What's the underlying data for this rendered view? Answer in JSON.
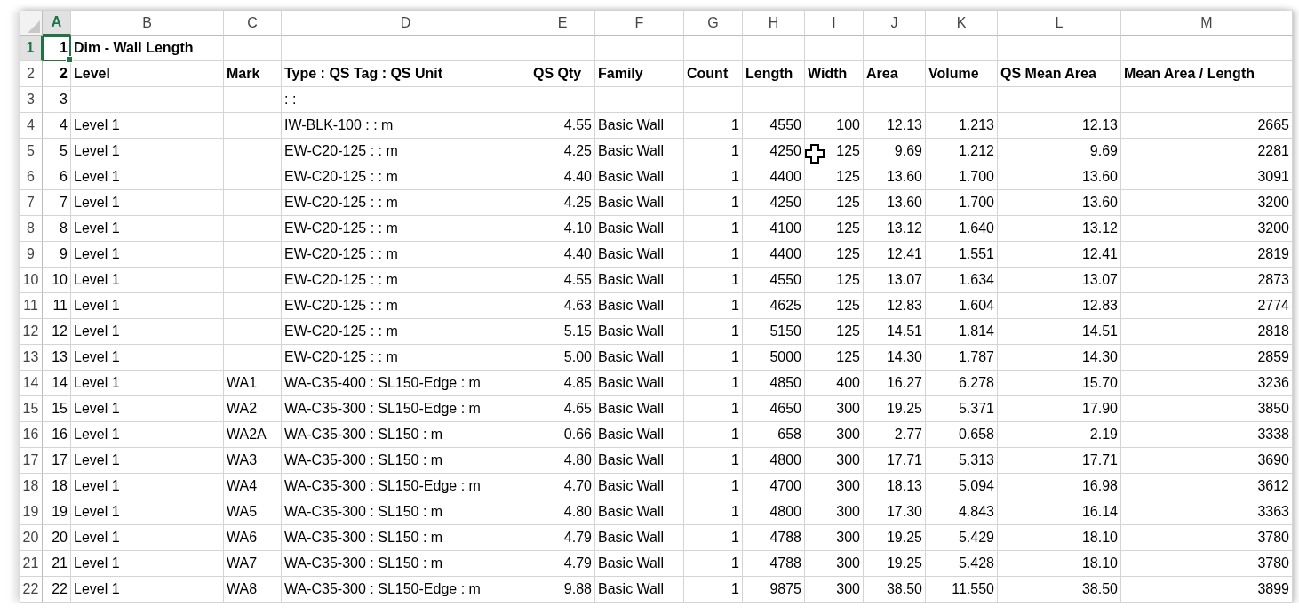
{
  "columns": [
    {
      "label": "A",
      "selected": true
    },
    {
      "label": "B",
      "selected": false
    },
    {
      "label": "C",
      "selected": false
    },
    {
      "label": "D",
      "selected": false
    },
    {
      "label": "E",
      "selected": false
    },
    {
      "label": "F",
      "selected": false
    },
    {
      "label": "G",
      "selected": false
    },
    {
      "label": "H",
      "selected": false
    },
    {
      "label": "I",
      "selected": false
    },
    {
      "label": "J",
      "selected": false
    },
    {
      "label": "K",
      "selected": false
    },
    {
      "label": "L",
      "selected": false
    },
    {
      "label": "M",
      "selected": false
    }
  ],
  "rows": [
    {
      "number": "1",
      "selected": true,
      "kind": "title",
      "cells": [
        "1",
        "Dim - Wall Length",
        "",
        "",
        "",
        "",
        "",
        "",
        "",
        "",
        "",
        "",
        ""
      ]
    },
    {
      "number": "2",
      "selected": false,
      "kind": "header",
      "cells": [
        "2",
        "Level",
        "Mark",
        "Type : QS Tag : QS Unit",
        "QS Qty",
        "Family",
        "Count",
        "Length",
        "Width",
        "Area",
        "Volume",
        "QS Mean Area",
        "Mean Area / Length"
      ]
    },
    {
      "number": "3",
      "selected": false,
      "kind": "data",
      "cells": [
        "3",
        "",
        "",
        " :  :",
        "",
        "",
        "",
        "",
        "",
        "",
        "",
        "",
        ""
      ]
    },
    {
      "number": "4",
      "selected": false,
      "kind": "data",
      "cells": [
        "4",
        "Level 1",
        "",
        "IW-BLK-100 :  : m",
        "4.55",
        "Basic Wall",
        "1",
        "4550",
        "100",
        "12.13",
        "1.213",
        "12.13",
        "2665"
      ]
    },
    {
      "number": "5",
      "selected": false,
      "kind": "data",
      "cells": [
        "5",
        "Level 1",
        "",
        "EW-C20-125 :  : m",
        "4.25",
        "Basic Wall",
        "1",
        "4250",
        "125",
        "9.69",
        "1.212",
        "9.69",
        "2281"
      ]
    },
    {
      "number": "6",
      "selected": false,
      "kind": "data",
      "cells": [
        "6",
        "Level 1",
        "",
        "EW-C20-125 :  : m",
        "4.40",
        "Basic Wall",
        "1",
        "4400",
        "125",
        "13.60",
        "1.700",
        "13.60",
        "3091"
      ]
    },
    {
      "number": "7",
      "selected": false,
      "kind": "data",
      "cells": [
        "7",
        "Level 1",
        "",
        "EW-C20-125 :  : m",
        "4.25",
        "Basic Wall",
        "1",
        "4250",
        "125",
        "13.60",
        "1.700",
        "13.60",
        "3200"
      ]
    },
    {
      "number": "8",
      "selected": false,
      "kind": "data",
      "cells": [
        "8",
        "Level 1",
        "",
        "EW-C20-125 :  : m",
        "4.10",
        "Basic Wall",
        "1",
        "4100",
        "125",
        "13.12",
        "1.640",
        "13.12",
        "3200"
      ]
    },
    {
      "number": "9",
      "selected": false,
      "kind": "data",
      "cells": [
        "9",
        "Level 1",
        "",
        "EW-C20-125 :  : m",
        "4.40",
        "Basic Wall",
        "1",
        "4400",
        "125",
        "12.41",
        "1.551",
        "12.41",
        "2819"
      ]
    },
    {
      "number": "10",
      "selected": false,
      "kind": "data",
      "cells": [
        "10",
        "Level 1",
        "",
        "EW-C20-125 :  : m",
        "4.55",
        "Basic Wall",
        "1",
        "4550",
        "125",
        "13.07",
        "1.634",
        "13.07",
        "2873"
      ]
    },
    {
      "number": "11",
      "selected": false,
      "kind": "data",
      "cells": [
        "11",
        "Level 1",
        "",
        "EW-C20-125 :  : m",
        "4.63",
        "Basic Wall",
        "1",
        "4625",
        "125",
        "12.83",
        "1.604",
        "12.83",
        "2774"
      ]
    },
    {
      "number": "12",
      "selected": false,
      "kind": "data",
      "cells": [
        "12",
        "Level 1",
        "",
        "EW-C20-125 :  : m",
        "5.15",
        "Basic Wall",
        "1",
        "5150",
        "125",
        "14.51",
        "1.814",
        "14.51",
        "2818"
      ]
    },
    {
      "number": "13",
      "selected": false,
      "kind": "data",
      "cells": [
        "13",
        "Level 1",
        "",
        "EW-C20-125 :  : m",
        "5.00",
        "Basic Wall",
        "1",
        "5000",
        "125",
        "14.30",
        "1.787",
        "14.30",
        "2859"
      ]
    },
    {
      "number": "14",
      "selected": false,
      "kind": "data",
      "cells": [
        "14",
        "Level 1",
        "WA1",
        "WA-C35-400 : SL150-Edge : m",
        "4.85",
        "Basic Wall",
        "1",
        "4850",
        "400",
        "16.27",
        "6.278",
        "15.70",
        "3236"
      ]
    },
    {
      "number": "15",
      "selected": false,
      "kind": "data",
      "cells": [
        "15",
        "Level 1",
        "WA2",
        "WA-C35-300 : SL150-Edge : m",
        "4.65",
        "Basic Wall",
        "1",
        "4650",
        "300",
        "19.25",
        "5.371",
        "17.90",
        "3850"
      ]
    },
    {
      "number": "16",
      "selected": false,
      "kind": "data",
      "cells": [
        "16",
        "Level 1",
        "WA2A",
        "WA-C35-300 : SL150 : m",
        "0.66",
        "Basic Wall",
        "1",
        "658",
        "300",
        "2.77",
        "0.658",
        "2.19",
        "3338"
      ]
    },
    {
      "number": "17",
      "selected": false,
      "kind": "data",
      "cells": [
        "17",
        "Level 1",
        "WA3",
        "WA-C35-300 : SL150 : m",
        "4.80",
        "Basic Wall",
        "1",
        "4800",
        "300",
        "17.71",
        "5.313",
        "17.71",
        "3690"
      ]
    },
    {
      "number": "18",
      "selected": false,
      "kind": "data",
      "cells": [
        "18",
        "Level 1",
        "WA4",
        "WA-C35-300 : SL150-Edge : m",
        "4.70",
        "Basic Wall",
        "1",
        "4700",
        "300",
        "18.13",
        "5.094",
        "16.98",
        "3612"
      ]
    },
    {
      "number": "19",
      "selected": false,
      "kind": "data",
      "cells": [
        "19",
        "Level 1",
        "WA5",
        "WA-C35-300 : SL150 : m",
        "4.80",
        "Basic Wall",
        "1",
        "4800",
        "300",
        "17.30",
        "4.843",
        "16.14",
        "3363"
      ]
    },
    {
      "number": "20",
      "selected": false,
      "kind": "data",
      "cells": [
        "20",
        "Level 1",
        "WA6",
        "WA-C35-300 : SL150 : m",
        "4.79",
        "Basic Wall",
        "1",
        "4788",
        "300",
        "19.25",
        "5.429",
        "18.10",
        "3780"
      ]
    },
    {
      "number": "21",
      "selected": false,
      "kind": "data",
      "cells": [
        "21",
        "Level 1",
        "WA7",
        "WA-C35-300 : SL150 : m",
        "4.79",
        "Basic Wall",
        "1",
        "4788",
        "300",
        "19.25",
        "5.428",
        "18.10",
        "3780"
      ]
    },
    {
      "number": "22",
      "selected": false,
      "kind": "data",
      "cells": [
        "22",
        "Level 1",
        "WA8",
        "WA-C35-300 : SL150-Edge : m",
        "9.88",
        "Basic Wall",
        "1",
        "9875",
        "300",
        "38.50",
        "11.550",
        "38.50",
        "3899"
      ]
    }
  ]
}
